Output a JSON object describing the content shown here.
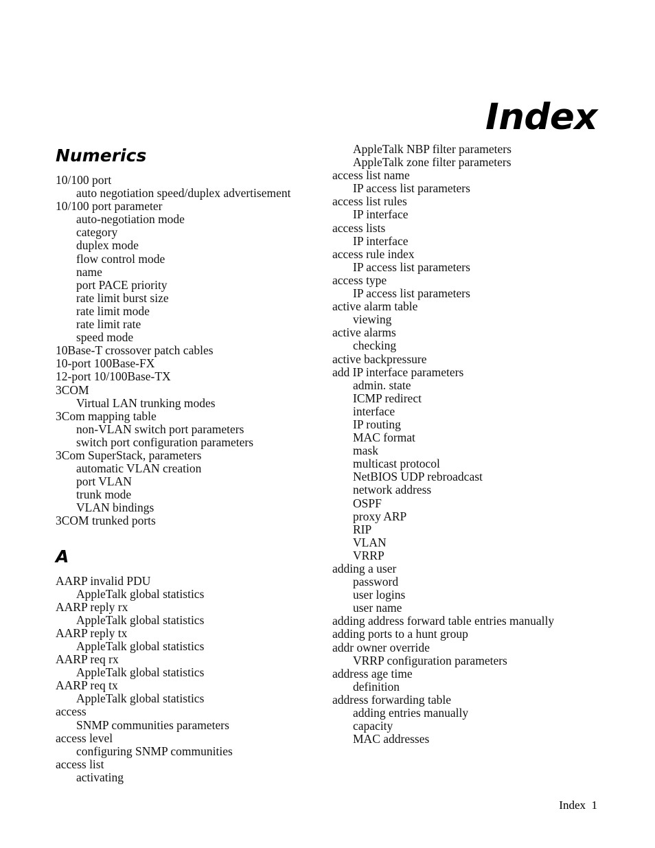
{
  "document": {
    "title": "Index",
    "background_color": "#ffffff",
    "text_color": "#111111"
  },
  "footer": {
    "folio": "Index  1"
  },
  "columns": [
    {
      "id": "left-column",
      "sections": [
        {
          "heading": "Numerics",
          "entries": [
            {
              "text": "10/100 port",
              "level": 0
            },
            {
              "text": "auto negotiation speed/duplex advertisement",
              "level": 1
            },
            {
              "text": "10/100 port parameter",
              "level": 0
            },
            {
              "text": "auto-negotiation mode",
              "level": 1
            },
            {
              "text": "category",
              "level": 1
            },
            {
              "text": "duplex mode",
              "level": 1
            },
            {
              "text": "flow control mode",
              "level": 1
            },
            {
              "text": "name",
              "level": 1
            },
            {
              "text": "port PACE priority",
              "level": 1
            },
            {
              "text": "rate limit burst size",
              "level": 1
            },
            {
              "text": "rate limit mode",
              "level": 1
            },
            {
              "text": "rate limit rate",
              "level": 1
            },
            {
              "text": "speed mode",
              "level": 1
            },
            {
              "text": "10Base-T crossover patch cables",
              "level": 0
            },
            {
              "text": "10-port 100Base-FX",
              "level": 0
            },
            {
              "text": "12-port 10/100Base-TX",
              "level": 0
            },
            {
              "text": "3COM",
              "level": 0
            },
            {
              "text": "Virtual LAN trunking modes",
              "level": 1
            },
            {
              "text": "3Com mapping table",
              "level": 0
            },
            {
              "text": "non-VLAN switch port parameters",
              "level": 1
            },
            {
              "text": "switch port configuration parameters",
              "level": 1
            },
            {
              "text": "3Com SuperStack, parameters",
              "level": 0
            },
            {
              "text": "automatic VLAN creation",
              "level": 1
            },
            {
              "text": "port VLAN",
              "level": 1
            },
            {
              "text": "trunk mode",
              "level": 1
            },
            {
              "text": "VLAN bindings",
              "level": 1
            },
            {
              "text": "3COM trunked ports",
              "level": 0
            }
          ]
        },
        {
          "heading": "A",
          "entries": [
            {
              "text": "AARP invalid PDU",
              "level": 0
            },
            {
              "text": "AppleTalk global statistics",
              "level": 1
            },
            {
              "text": "AARP reply rx",
              "level": 0
            },
            {
              "text": "AppleTalk global statistics",
              "level": 1
            },
            {
              "text": "AARP reply tx",
              "level": 0
            },
            {
              "text": "AppleTalk global statistics",
              "level": 1
            },
            {
              "text": "AARP req rx",
              "level": 0
            },
            {
              "text": "AppleTalk global statistics",
              "level": 1
            },
            {
              "text": "AARP req tx",
              "level": 0
            },
            {
              "text": "AppleTalk global statistics",
              "level": 1
            },
            {
              "text": "access",
              "level": 0
            },
            {
              "text": "SNMP communities parameters",
              "level": 1
            },
            {
              "text": "access level",
              "level": 0
            },
            {
              "text": "configuring SNMP communities",
              "level": 1
            },
            {
              "text": "access list",
              "level": 0
            },
            {
              "text": "activating",
              "level": 1
            }
          ]
        }
      ]
    },
    {
      "id": "right-column",
      "sections": [
        {
          "heading": "",
          "entries": [
            {
              "text": "AppleTalk NBP filter parameters",
              "level": 1
            },
            {
              "text": "AppleTalk zone filter parameters",
              "level": 1
            },
            {
              "text": "access list name",
              "level": 0
            },
            {
              "text": "IP access list parameters",
              "level": 1
            },
            {
              "text": "access list rules",
              "level": 0
            },
            {
              "text": "IP interface",
              "level": 1
            },
            {
              "text": "access lists",
              "level": 0
            },
            {
              "text": "IP interface",
              "level": 1
            },
            {
              "text": "access rule index",
              "level": 0
            },
            {
              "text": "IP access list parameters",
              "level": 1
            },
            {
              "text": "access type",
              "level": 0
            },
            {
              "text": "IP access list parameters",
              "level": 1
            },
            {
              "text": "active alarm table",
              "level": 0
            },
            {
              "text": "viewing",
              "level": 1
            },
            {
              "text": "active alarms",
              "level": 0
            },
            {
              "text": "checking",
              "level": 1
            },
            {
              "text": "active backpressure",
              "level": 0
            },
            {
              "text": "add IP interface parameters",
              "level": 0
            },
            {
              "text": "admin. state",
              "level": 1
            },
            {
              "text": "ICMP redirect",
              "level": 1
            },
            {
              "text": "interface",
              "level": 1
            },
            {
              "text": "IP routing",
              "level": 1
            },
            {
              "text": "MAC format",
              "level": 1
            },
            {
              "text": "mask",
              "level": 1
            },
            {
              "text": "multicast protocol",
              "level": 1
            },
            {
              "text": "NetBIOS UDP rebroadcast",
              "level": 1
            },
            {
              "text": "network address",
              "level": 1
            },
            {
              "text": "OSPF",
              "level": 1
            },
            {
              "text": "proxy ARP",
              "level": 1
            },
            {
              "text": "RIP",
              "level": 1
            },
            {
              "text": "VLAN",
              "level": 1
            },
            {
              "text": "VRRP",
              "level": 1
            },
            {
              "text": "adding a user",
              "level": 0
            },
            {
              "text": "password",
              "level": 1
            },
            {
              "text": "user logins",
              "level": 1
            },
            {
              "text": "user name",
              "level": 1
            },
            {
              "text": "adding address forward table entries manually",
              "level": 0
            },
            {
              "text": "adding ports to a hunt group",
              "level": 0
            },
            {
              "text": "addr owner override",
              "level": 0
            },
            {
              "text": "VRRP configuration parameters",
              "level": 1
            },
            {
              "text": "address age time",
              "level": 0
            },
            {
              "text": "definition",
              "level": 1
            },
            {
              "text": "address forwarding table",
              "level": 0
            },
            {
              "text": "adding entries manually",
              "level": 1
            },
            {
              "text": "capacity",
              "level": 1
            },
            {
              "text": "MAC addresses",
              "level": 1
            }
          ]
        }
      ]
    }
  ]
}
